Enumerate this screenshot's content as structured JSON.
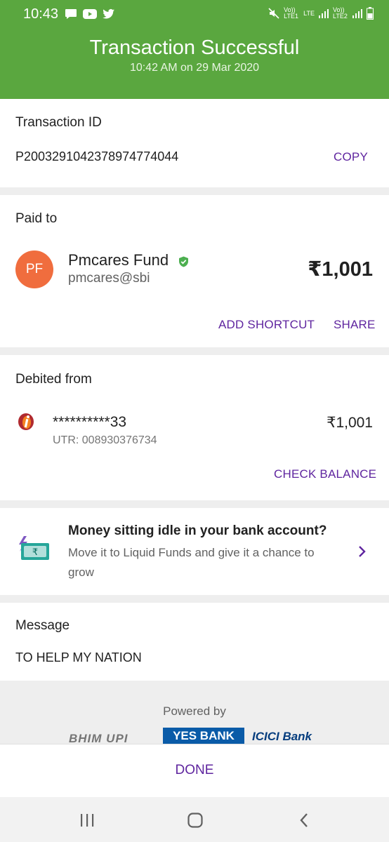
{
  "status_bar": {
    "time": "10:43",
    "sim1": "Vo)) LTE1",
    "lte": "LTE",
    "sim2": "Vo)) LTE2"
  },
  "header": {
    "title": "Transaction Successful",
    "subtitle": "10:42 AM on 29 Mar 2020"
  },
  "transaction": {
    "label": "Transaction ID",
    "id": "P2003291042378974774044",
    "copy_label": "COPY"
  },
  "paid_to": {
    "label": "Paid to",
    "avatar_initials": "PF",
    "name": "Pmcares Fund",
    "upi_id": "pmcares@sbi",
    "amount": "₹1,001",
    "add_shortcut_label": "ADD SHORTCUT",
    "share_label": "SHARE"
  },
  "debited_from": {
    "label": "Debited from",
    "account": "**********33",
    "utr": "UTR: 008930376734",
    "amount": "₹1,001",
    "check_balance_label": "CHECK BALANCE"
  },
  "promo": {
    "title": "Money sitting idle in your bank account?",
    "text": "Move it to Liquid Funds and give it a chance to grow"
  },
  "message": {
    "label": "Message",
    "text": "TO HELP MY NATION"
  },
  "footer": {
    "powered_by": "Powered by",
    "bhim_upi": "BHIM UPI",
    "yes_bank": "YES BANK",
    "icici_bank": "ICICI Bank"
  },
  "done_label": "DONE",
  "colors": {
    "header_green": "#5aa73f",
    "accent_purple": "#5f259f",
    "avatar_orange": "#f06d3e",
    "verified_green": "#4caf50"
  }
}
